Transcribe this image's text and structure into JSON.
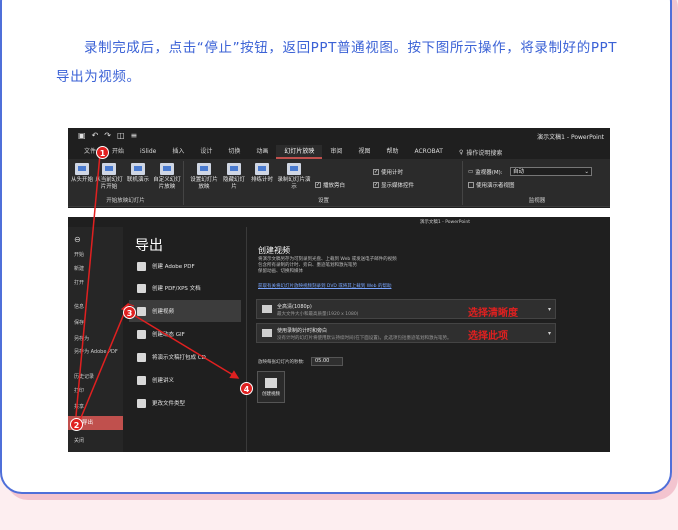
{
  "instruction": "录制完成后，点击“停止”按钮，返回PPT普通视图。按下图所示操作，将录制好的PPT导出为视频。",
  "screenshot": {
    "qat_icons": [
      "save-icon",
      "undo-icon",
      "redo-icon",
      "present-icon",
      "customize-icon"
    ],
    "doc_title": "演示文稿1 - PowerPoint",
    "tabs": [
      "文件",
      "开始",
      "iSlide",
      "插入",
      "设计",
      "切换",
      "动画",
      "幻灯片放映",
      "审阅",
      "视图",
      "帮助",
      "ACROBAT"
    ],
    "active_tab": "幻灯片放映",
    "search_label": "操作说明搜索",
    "ribbon": {
      "group1_buttons": [
        "从头开始",
        "从当前幻灯片开始",
        "联机演示",
        "自定义幻灯片放映"
      ],
      "group1_label": "开始放映幻灯片",
      "group2_buttons": [
        "设置幻灯片放映",
        "隐藏幻灯片",
        "排练计时",
        "录制幻灯片演示"
      ],
      "group2_checks": [
        {
          "label": "播放旁白",
          "checked": true
        },
        {
          "label": "使用计时",
          "checked": true
        },
        {
          "label": "显示媒体控件",
          "checked": true
        }
      ],
      "group2_label": "设置",
      "monitor_label": "监视器(M):",
      "monitor_value": "自动",
      "presenter_view": "使用演示者视图",
      "group3_label": "监视器"
    },
    "inner_title": "演示文稿1 - PowerPoint",
    "sidebar": [
      "开始",
      "新建",
      "打开",
      "信息",
      "保存",
      "另存为",
      "另存为 Adobe PDF",
      "历史记录",
      "打印",
      "共享",
      "导出",
      "关闭"
    ],
    "sidebar_selected": "导出",
    "export_title": "导出",
    "export_options": [
      "创建 Adobe PDF",
      "创建 PDF/XPS 文档",
      "创建视频",
      "创建动态 GIF",
      "将演示文稿打包成 CD",
      "创建讲义",
      "更改文件类型"
    ],
    "export_selected": "创建视频",
    "create_video": {
      "title": "创建视频",
      "desc": [
        "将演示文稿另存为可刻录到光盘、上载到 Web 或发送电子邮件的视频",
        "包含所有录制的计时、旁白、墨迹笔划和激光笔势",
        "保留动画、切换和媒体"
      ],
      "link": "获取有关将幻灯片放映视频刻录到 DVD 或将其上载到 Web 的帮助",
      "quality_main": "全高清(1080p)",
      "quality_sub": "最大文件大小和最高质量(1920 x 1080)",
      "timing_main": "使用录制的计时和旁白",
      "timing_sub": "没有计时的幻灯片将使用默认持续时间(在下面设置)。此选项包括墨迹笔划和激光笔势。",
      "seconds_label": "放映每张幻灯片的秒数:",
      "seconds_value": "05.00",
      "create_button": "创建视频"
    },
    "annotations": {
      "quality_note": "选择清晰度",
      "timing_note": "选择此项"
    },
    "badges": [
      "1",
      "2",
      "3",
      "4"
    ]
  }
}
